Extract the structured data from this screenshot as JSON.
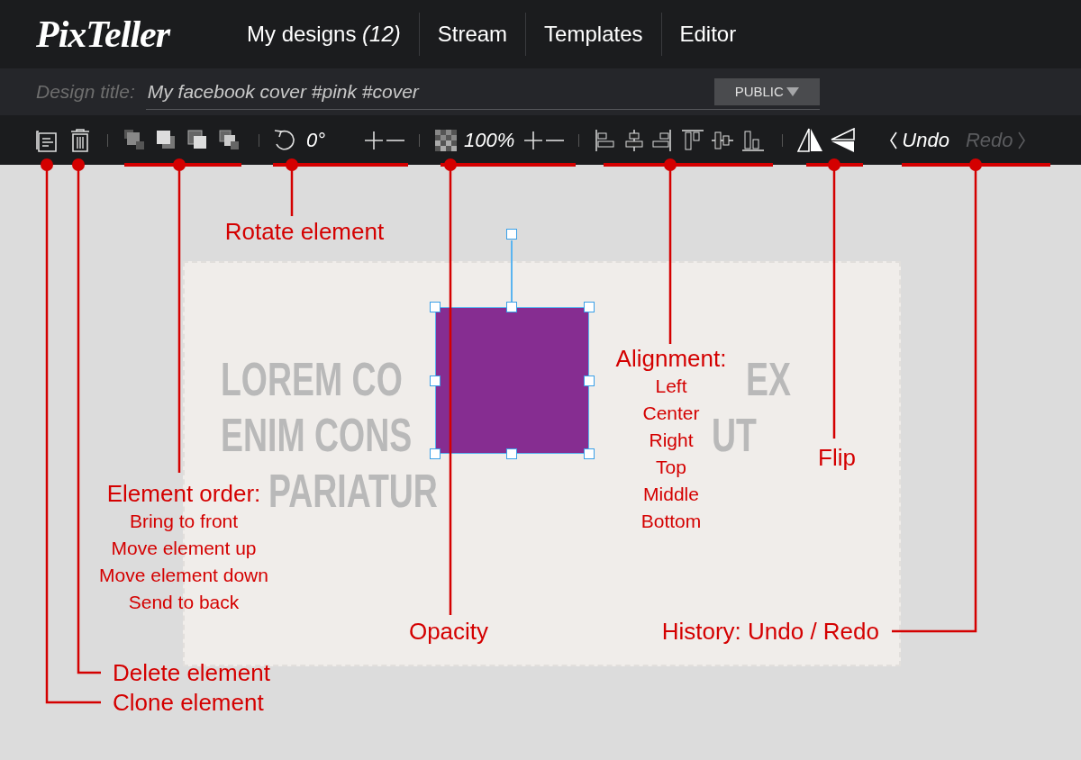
{
  "header": {
    "logo": "PixTeller",
    "nav": [
      {
        "label": "My designs",
        "count": "(12)"
      },
      {
        "label": "Stream"
      },
      {
        "label": "Templates"
      },
      {
        "label": "Editor"
      }
    ]
  },
  "title_bar": {
    "label": "Design title:",
    "value": "My facebook cover #pink #cover",
    "visibility": "PUBLIC"
  },
  "toolbar": {
    "rotation": "0°",
    "opacity": "100%",
    "undo": {
      "label": "Undo",
      "disabled": false
    },
    "redo": {
      "label": "Redo",
      "disabled": true
    }
  },
  "canvas": {
    "text_lines": [
      {
        "segments": [
          "LOREM CO",
          "EX"
        ]
      },
      {
        "segments": [
          "ENIM CONS",
          "UT"
        ]
      },
      {
        "segments": [
          "PARIATUR"
        ]
      }
    ]
  },
  "annotations": [
    {
      "kind": "rotate",
      "title": "Rotate element"
    },
    {
      "kind": "align",
      "title": "Alignment:",
      "items": [
        "Left",
        "Center",
        "Right",
        "Top",
        "Middle",
        "Bottom"
      ]
    },
    {
      "kind": "flip",
      "title": "Flip"
    },
    {
      "kind": "order",
      "title": "Element order:",
      "items": [
        "Bring to front",
        "Move element up",
        "Move element down",
        "Send to back"
      ]
    },
    {
      "kind": "opacity",
      "title": "Opacity"
    },
    {
      "kind": "history",
      "title": "History: Undo / Redo"
    },
    {
      "kind": "delete",
      "title": "Delete element"
    },
    {
      "kind": "clone",
      "title": "Clone element"
    }
  ]
}
